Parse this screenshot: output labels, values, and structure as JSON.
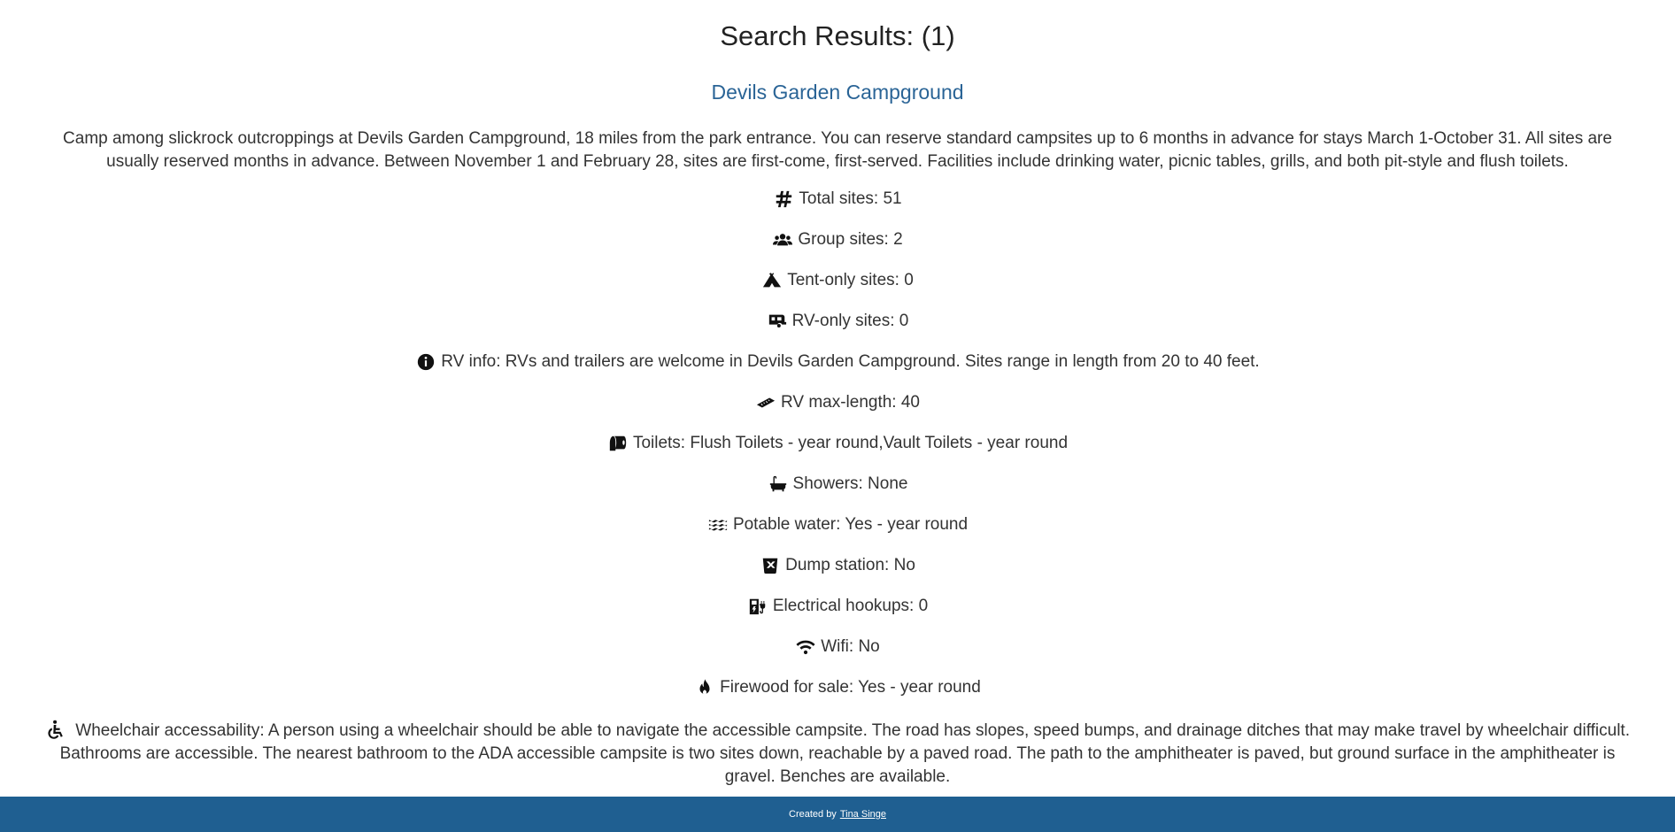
{
  "page": {
    "title": "Search Results: (1)"
  },
  "campground": {
    "name": "Devils Garden Campground",
    "description": "Camp among slickrock outcroppings at Devils Garden Campground, 18 miles from the park entrance. You can reserve standard campsites up to 6 months in advance for stays March 1-October 31. All sites are usually reserved months in advance. Between November 1 and February 28, sites are first-come, first-served. Facilities include drinking water, picnic tables, grills, and both pit-style and flush toilets.",
    "details": [
      {
        "icon": "hashtag-icon",
        "text": "Total sites: 51"
      },
      {
        "icon": "group-icon",
        "text": "Group sites: 2"
      },
      {
        "icon": "tent-icon",
        "text": "Tent-only sites: 0"
      },
      {
        "icon": "rv-icon",
        "text": "RV-only sites: 0"
      },
      {
        "icon": "info-icon",
        "text": "RV info: RVs and trailers are welcome in Devils Garden Campground. Sites range in length from 20 to 40 feet."
      },
      {
        "icon": "ruler-icon",
        "text": "RV max-length: 40"
      },
      {
        "icon": "toilet-paper-icon",
        "text": "Toilets: Flush Toilets - year round,Vault Toilets - year round"
      },
      {
        "icon": "bath-icon",
        "text": "Showers: None"
      },
      {
        "icon": "water-icon",
        "text": "Potable water: Yes - year round"
      },
      {
        "icon": "dump-station-icon",
        "text": "Dump station: No"
      },
      {
        "icon": "charging-station-icon",
        "text": "Electrical hookups: 0"
      },
      {
        "icon": "wifi-icon",
        "text": "Wifi: No"
      },
      {
        "icon": "fire-icon",
        "text": "Firewood for sale: Yes - year round"
      }
    ],
    "accessibility": {
      "icon": "wheelchair-icon",
      "text": "Wheelchair accessability: A person using a wheelchair should be able to navigate the accessible campsite. The road has slopes, speed bumps, and drainage ditches that may make travel by wheelchair difficult. Bathrooms are accessible. The nearest bathroom to the ADA accessible campsite is two sites down, reachable by a paved road. The path to the amphitheater is paved, but ground surface in the amphitheater is gravel. Benches are available."
    }
  },
  "footer": {
    "prefix": "Created by",
    "author": "Tina Singe"
  }
}
